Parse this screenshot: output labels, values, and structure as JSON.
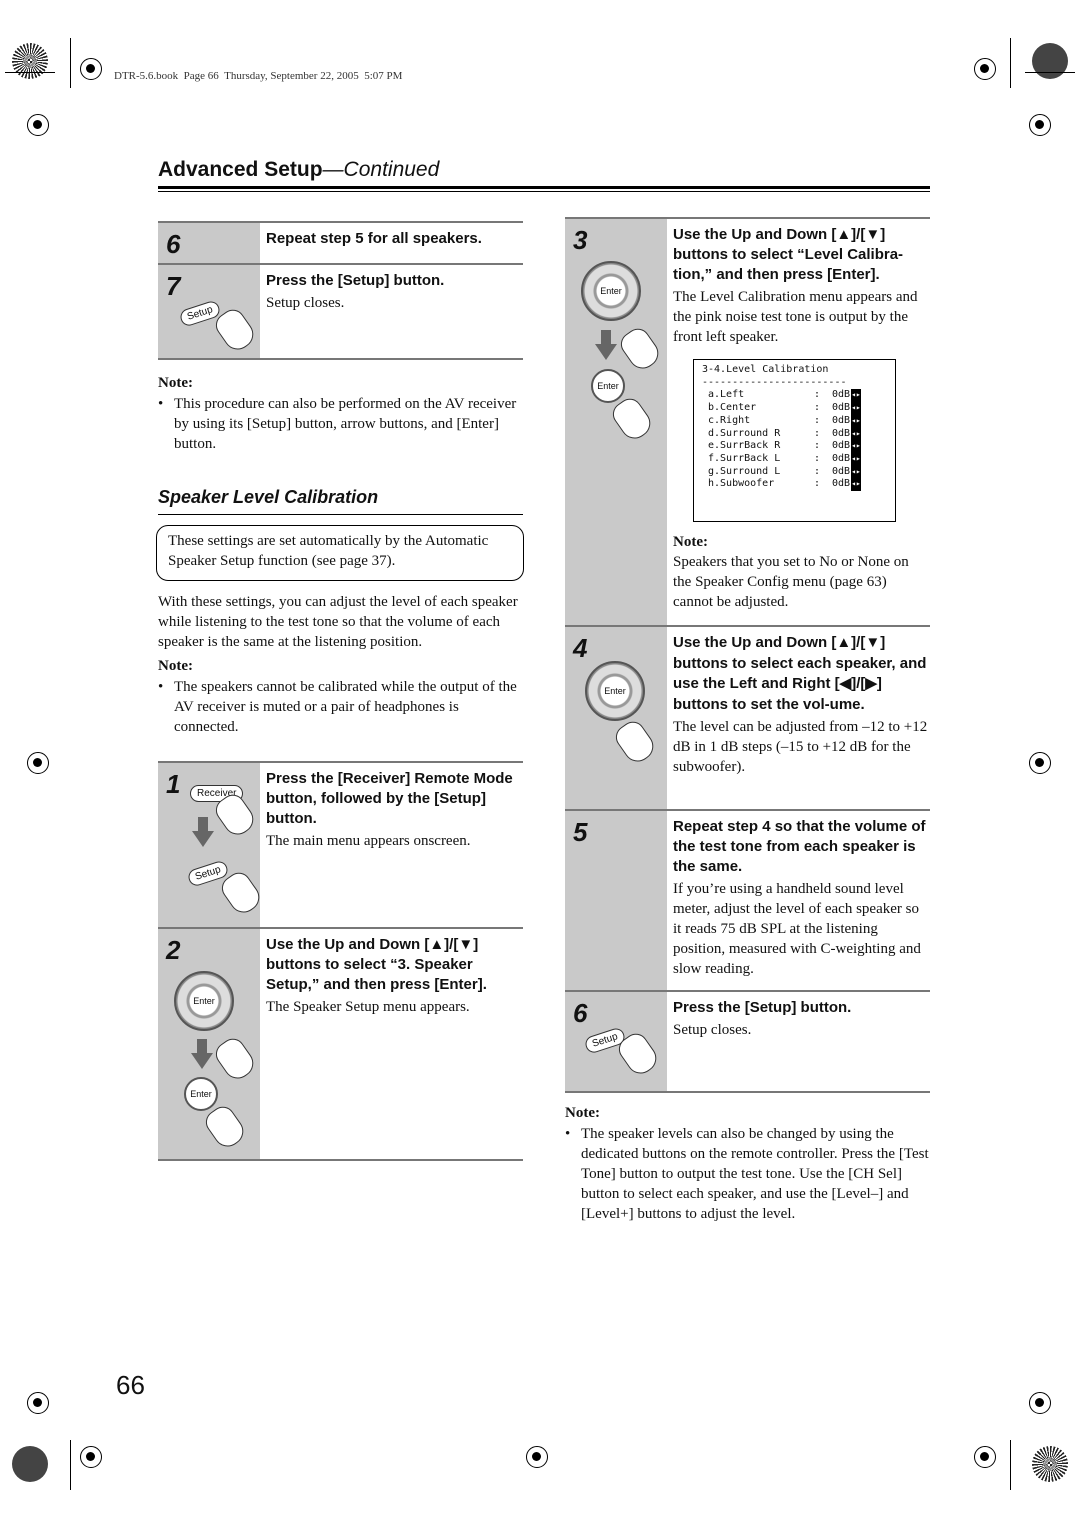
{
  "print_header": "DTR-5.6.book  Page 66  Thursday, September 22, 2005  5:07 PM",
  "title": {
    "main": "Advanced Setup",
    "suffix": "—Continued"
  },
  "left": {
    "step6": {
      "num": "6",
      "title": "Repeat step 5 for all speakers."
    },
    "step7": {
      "num": "7",
      "title": "Press the [Setup] button.",
      "body": "Setup closes.",
      "icon_label": "Setup"
    },
    "note1": {
      "label": "Note:",
      "bullet": "This procedure can also be performed on the AV receiver by using its [Setup] button, arrow buttons, and [Enter] button."
    },
    "section_heading": "Speaker Level Calibration",
    "boxed_text": "These settings are set automatically by the Automatic Speaker Setup function (see page 37).",
    "paragraph": "With these settings, you can adjust the level of each speaker while listening to the test tone so that the volume of each speaker is the same at the listening position.",
    "note2": {
      "label": "Note:",
      "bullet": "The speakers cannot be calibrated while the output of the AV receiver is muted or a pair of headphones is connected."
    },
    "step1": {
      "num": "1",
      "title": "Press the [Receiver] Remote Mode button, followed by the [Setup] button.",
      "body": "The main menu appears onscreen.",
      "icon_label_1": "Receiver",
      "icon_label_2": "Setup"
    },
    "step2": {
      "num": "2",
      "title": "Use the Up and Down [▲]/[▼] buttons to select “3. Speaker Setup,” and then press [Enter].",
      "body": "The Speaker Setup menu appears.",
      "icon_label_1": "Enter",
      "icon_label_2": "Enter"
    }
  },
  "right": {
    "step3": {
      "num": "3",
      "title": "Use the Up and Down [▲]/[▼] buttons to select “Level Calibra-tion,” and then press [Enter].",
      "body": "The Level Calibration menu appears and the pink noise test tone is output by the front left speaker.",
      "icon_label_1": "Enter",
      "icon_label_2": "Enter",
      "menu": {
        "title": "3-4.Level Calibration",
        "rule": "------------------------",
        "rows": [
          {
            "name": "a.Left",
            "value": "0dB"
          },
          {
            "name": "b.Center",
            "value": "0dB"
          },
          {
            "name": "c.Right",
            "value": "0dB"
          },
          {
            "name": "d.Surround R",
            "value": "0dB"
          },
          {
            "name": "e.SurrBack R",
            "value": "0dB"
          },
          {
            "name": "f.SurrBack L",
            "value": "0dB"
          },
          {
            "name": "g.Surround L",
            "value": "0dB"
          },
          {
            "name": "h.Subwoofer",
            "value": "0dB"
          }
        ]
      },
      "note": {
        "label": "Note:",
        "text": "Speakers that you set to No or None on the Speaker Config menu (page 63) cannot be adjusted."
      }
    },
    "step4": {
      "num": "4",
      "title": "Use the Up and Down [▲]/[▼] buttons to select each speaker, and use the Left and Right [◀]/[▶] buttons to set the vol-ume.",
      "body": "The level can be adjusted from –12 to +12 dB in 1 dB steps (–15 to +12 dB for the subwoofer).",
      "icon_label": "Enter"
    },
    "step5": {
      "num": "5",
      "title": "Repeat step 4 so that the volume of the test tone from each speaker is the same.",
      "body": "If you’re using a handheld sound level meter, adjust the level of each speaker so it reads 75 dB SPL at the listening position, measured with C-weighting and slow reading."
    },
    "step6": {
      "num": "6",
      "title": "Press the [Setup] button.",
      "body": "Setup closes.",
      "icon_label": "Setup"
    },
    "note": {
      "label": "Note:",
      "bullet": "The speaker levels can also be changed by using the dedicated buttons on the remote controller. Press the [Test Tone] button to output the test tone. Use the [CH Sel] button to select each speaker, and use the [Level–] and [Level+] buttons to adjust the level."
    }
  },
  "page_number": "66"
}
